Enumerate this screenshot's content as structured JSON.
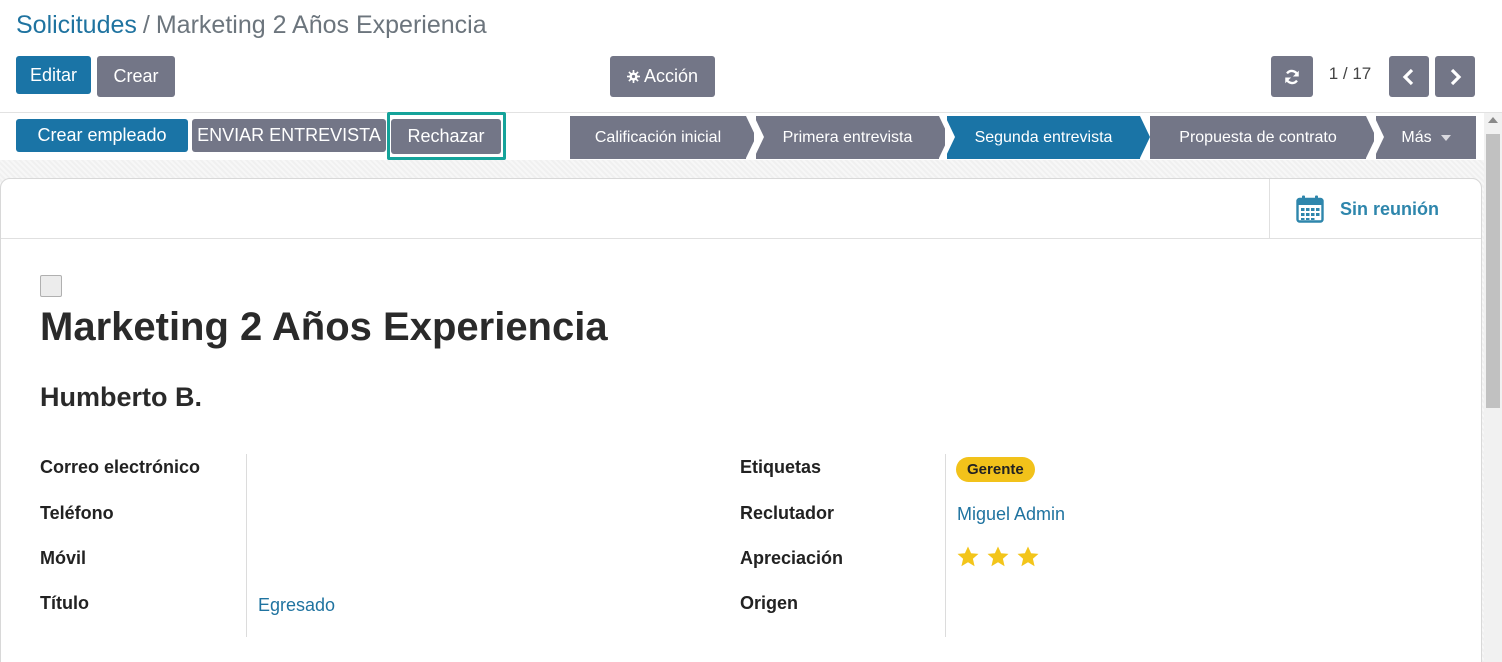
{
  "breadcrumb": {
    "parent": "Solicitudes",
    "separator": "/",
    "current": "Marketing 2 Años Experiencia"
  },
  "toolbar": {
    "edit_label": "Editar",
    "create_label": "Crear",
    "action_label": "Acción",
    "action_icon": "gear-icon"
  },
  "pager": {
    "value": "1 / 17",
    "refresh_icon": "refresh-icon",
    "prev_icon": "chevron-left-icon",
    "next_icon": "chevron-right-icon"
  },
  "statusbar_buttons": {
    "create_employee": "Crear empleado",
    "send_interview": "ENVIAR ENTREVISTA",
    "reject": "Rechazar"
  },
  "stages": [
    {
      "label": "Calificación inicial",
      "active": false
    },
    {
      "label": "Primera entrevista",
      "active": false
    },
    {
      "label": "Segunda entrevista",
      "active": true
    },
    {
      "label": "Propuesta de contrato",
      "active": false
    },
    {
      "label": "Más",
      "active": false
    }
  ],
  "smart_button": {
    "label": "Sin reunión",
    "icon": "calendar-icon"
  },
  "record": {
    "title": "Marketing 2 Años Experiencia",
    "applicant_name": "Humberto B."
  },
  "fields_left": [
    {
      "label": "Correo electrónico",
      "value": ""
    },
    {
      "label": "Teléfono",
      "value": ""
    },
    {
      "label": "Móvil",
      "value": ""
    },
    {
      "label": "Título",
      "value": "Egresado"
    }
  ],
  "fields_right": {
    "tags_label": "Etiquetas",
    "tag": "Gerente",
    "recruiter_label": "Reclutador",
    "recruiter": "Miguel Admin",
    "appraisal_label": "Apreciación",
    "appraisal_stars": 3,
    "appraisal_max": 3,
    "source_label": "Origen",
    "source": ""
  },
  "colors": {
    "primary": "#1a74a6",
    "secondary": "#737687",
    "link": "#1f73a0",
    "tag": "#f2c21a",
    "star": "#f3c51a",
    "focus": "#15a39a"
  }
}
